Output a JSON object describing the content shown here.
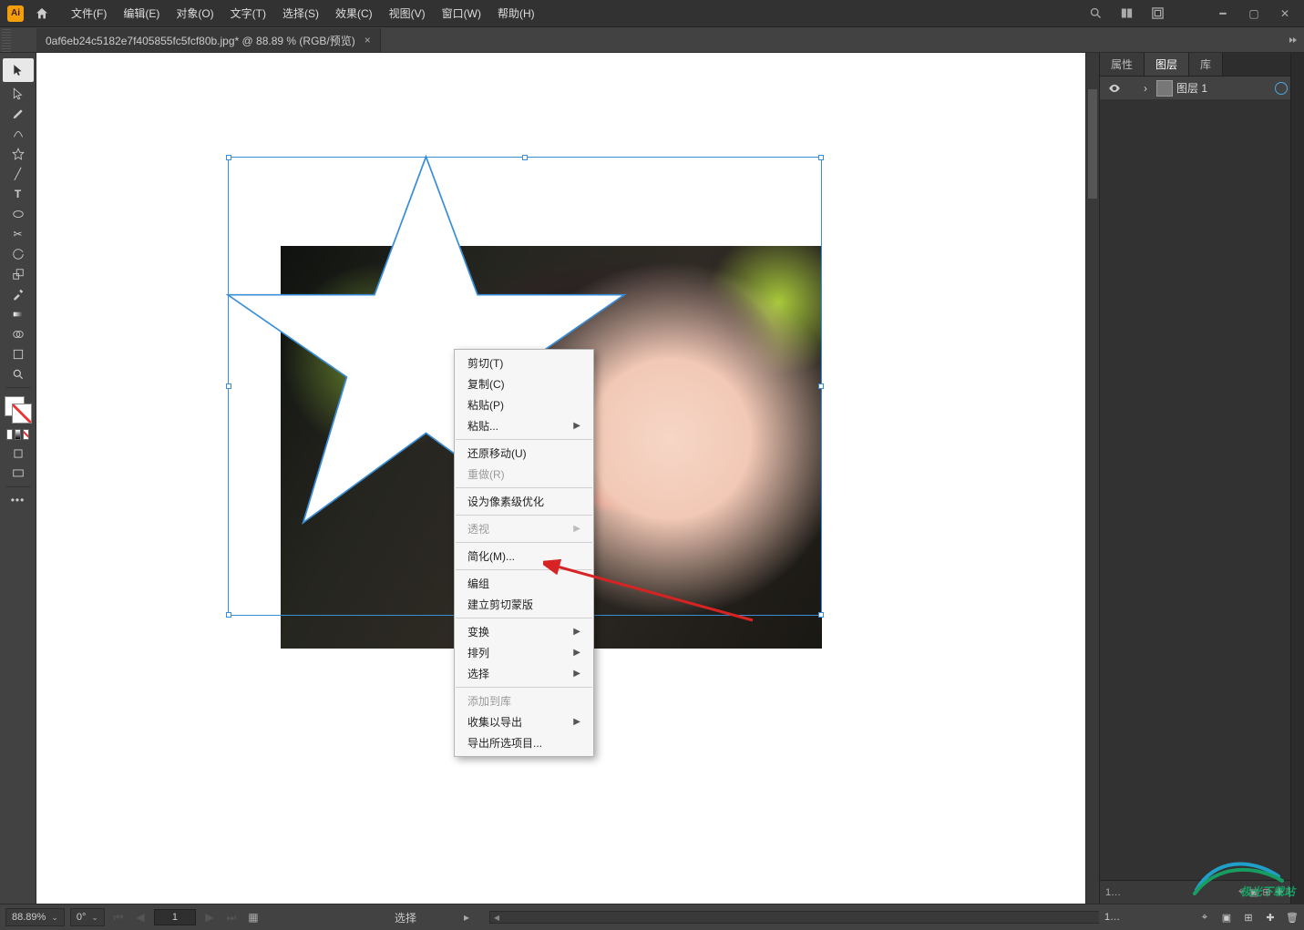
{
  "window": {
    "title": "Adobe Illustrator"
  },
  "menubar": {
    "items": [
      "文件(F)",
      "编辑(E)",
      "对象(O)",
      "文字(T)",
      "选择(S)",
      "效果(C)",
      "视图(V)",
      "窗口(W)",
      "帮助(H)"
    ]
  },
  "document_tab": {
    "label": "0af6eb24c5182e7f405855fc5fcf80b.jpg* @ 88.89 % (RGB/预览)",
    "close": "×"
  },
  "tools": {
    "names": [
      "selection",
      "direct-selection",
      "pen",
      "curvature",
      "star",
      "line",
      "type",
      "ellipse",
      "paintbrush",
      "rotate",
      "scale",
      "width",
      "eyedropper",
      "blend",
      "shape-builder",
      "artboard",
      "zoom"
    ]
  },
  "right_panel": {
    "tabs": {
      "properties": "属性",
      "layers": "图层",
      "libraries": "库"
    },
    "active_tab": "layers",
    "layer": {
      "name": "图层 1"
    },
    "footer": {
      "count": "1…",
      "expand_icon": "⇱"
    }
  },
  "context_menu": {
    "cut": "剪切(T)",
    "copy": "复制(C)",
    "paste": "粘贴(P)",
    "paste_sub": "粘贴...",
    "undo_move": "还原移动(U)",
    "redo": "重做(R)",
    "pixel_optimize": "设为像素级优化",
    "perspective": "透视",
    "simplify": "简化(M)...",
    "group": "编组",
    "make_clipping_mask": "建立剪切蒙版",
    "transform": "变换",
    "arrange": "排列",
    "select": "选择",
    "add_to_library": "添加到库",
    "collect_export": "收集以导出",
    "export_selection": "导出所选项目..."
  },
  "status": {
    "zoom": "88.89%",
    "angle": "0°",
    "artboard_num": "1",
    "mode": "选择"
  },
  "watermark": {
    "text": "极光下载站"
  }
}
